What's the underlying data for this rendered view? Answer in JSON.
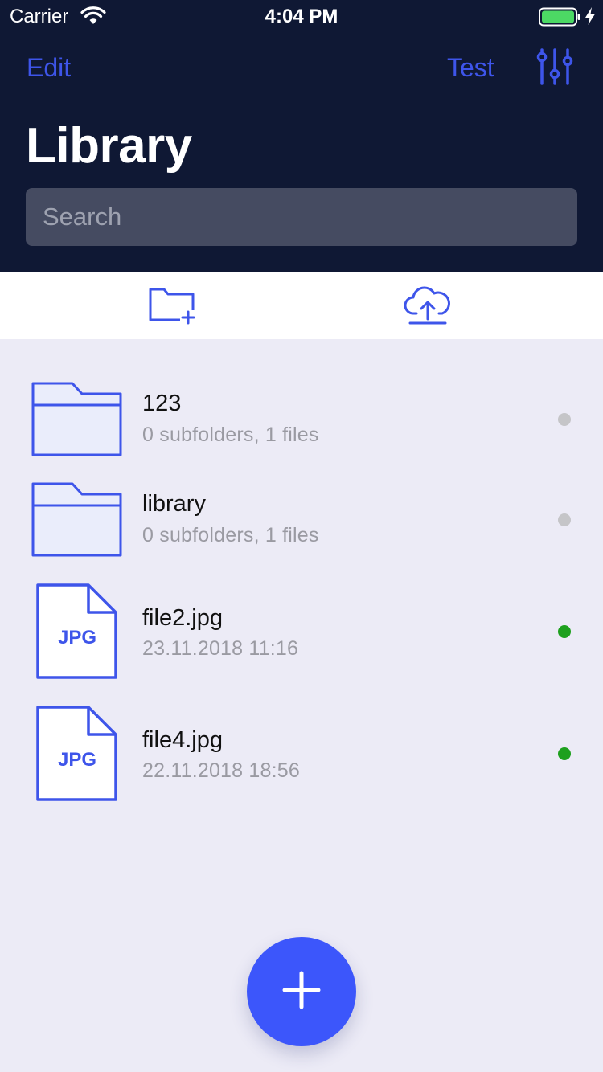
{
  "status_bar": {
    "carrier": "Carrier",
    "time": "4:04 PM",
    "icons": [
      "wifi-icon",
      "battery-icon",
      "charging-bolt-icon"
    ]
  },
  "nav": {
    "edit_label": "Edit",
    "test_label": "Test",
    "filter_icon": "sliders-icon"
  },
  "title": "Library",
  "search": {
    "placeholder": "Search",
    "value": ""
  },
  "toolbar": {
    "new_folder_icon": "folder-plus-icon",
    "upload_icon": "cloud-upload-icon"
  },
  "items": [
    {
      "type": "folder",
      "name": "123",
      "subtitle": "0 subfolders, 1 files",
      "status_color": "#c5c5c8"
    },
    {
      "type": "folder",
      "name": "library",
      "subtitle": "0 subfolders, 1 files",
      "status_color": "#c5c5c8"
    },
    {
      "type": "file",
      "badge": "JPG",
      "name": "file2.jpg",
      "subtitle": "23.11.2018 11:16",
      "status_color": "#1ea01e"
    },
    {
      "type": "file",
      "badge": "JPG",
      "name": "file4.jpg",
      "subtitle": "22.11.2018 18:56",
      "status_color": "#1ea01e"
    }
  ],
  "fab": {
    "icon": "plus-icon"
  },
  "colors": {
    "accent": "#3e55ea",
    "header_bg": "#0f1834",
    "list_bg": "#ecebf6",
    "fab": "#3c56fb"
  }
}
